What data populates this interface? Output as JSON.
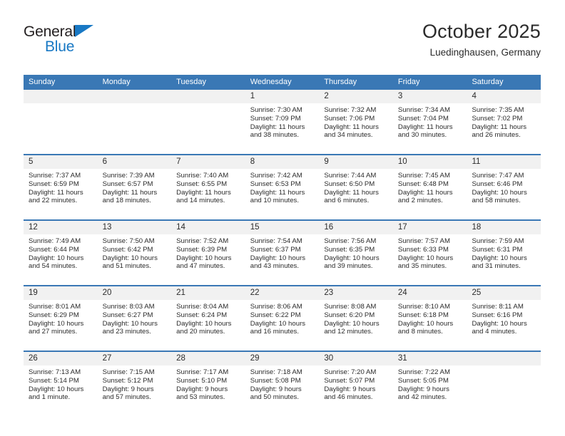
{
  "logo": {
    "line1": "General",
    "line2": "Blue",
    "triangle_icon": "blue-triangle-icon",
    "color_dark": "#231f20",
    "color_blue": "#1878c4"
  },
  "header": {
    "title": "October 2025",
    "subtitle": "Luedinghausen, Germany"
  },
  "theme": {
    "header_blue": "#3a78b5",
    "row_gray": "#f1f1f1",
    "text": "#2b2b2b"
  },
  "calendar": {
    "weekdays": [
      "Sunday",
      "Monday",
      "Tuesday",
      "Wednesday",
      "Thursday",
      "Friday",
      "Saturday"
    ],
    "weeks": [
      [
        {
          "day": "",
          "lines": []
        },
        {
          "day": "",
          "lines": []
        },
        {
          "day": "",
          "lines": []
        },
        {
          "day": "1",
          "lines": [
            "Sunrise: 7:30 AM",
            "Sunset: 7:09 PM",
            "Daylight: 11 hours and 38 minutes."
          ]
        },
        {
          "day": "2",
          "lines": [
            "Sunrise: 7:32 AM",
            "Sunset: 7:06 PM",
            "Daylight: 11 hours and 34 minutes."
          ]
        },
        {
          "day": "3",
          "lines": [
            "Sunrise: 7:34 AM",
            "Sunset: 7:04 PM",
            "Daylight: 11 hours and 30 minutes."
          ]
        },
        {
          "day": "4",
          "lines": [
            "Sunrise: 7:35 AM",
            "Sunset: 7:02 PM",
            "Daylight: 11 hours and 26 minutes."
          ]
        }
      ],
      [
        {
          "day": "5",
          "lines": [
            "Sunrise: 7:37 AM",
            "Sunset: 6:59 PM",
            "Daylight: 11 hours and 22 minutes."
          ]
        },
        {
          "day": "6",
          "lines": [
            "Sunrise: 7:39 AM",
            "Sunset: 6:57 PM",
            "Daylight: 11 hours and 18 minutes."
          ]
        },
        {
          "day": "7",
          "lines": [
            "Sunrise: 7:40 AM",
            "Sunset: 6:55 PM",
            "Daylight: 11 hours and 14 minutes."
          ]
        },
        {
          "day": "8",
          "lines": [
            "Sunrise: 7:42 AM",
            "Sunset: 6:53 PM",
            "Daylight: 11 hours and 10 minutes."
          ]
        },
        {
          "day": "9",
          "lines": [
            "Sunrise: 7:44 AM",
            "Sunset: 6:50 PM",
            "Daylight: 11 hours and 6 minutes."
          ]
        },
        {
          "day": "10",
          "lines": [
            "Sunrise: 7:45 AM",
            "Sunset: 6:48 PM",
            "Daylight: 11 hours and 2 minutes."
          ]
        },
        {
          "day": "11",
          "lines": [
            "Sunrise: 7:47 AM",
            "Sunset: 6:46 PM",
            "Daylight: 10 hours and 58 minutes."
          ]
        }
      ],
      [
        {
          "day": "12",
          "lines": [
            "Sunrise: 7:49 AM",
            "Sunset: 6:44 PM",
            "Daylight: 10 hours and 54 minutes."
          ]
        },
        {
          "day": "13",
          "lines": [
            "Sunrise: 7:50 AM",
            "Sunset: 6:42 PM",
            "Daylight: 10 hours and 51 minutes."
          ]
        },
        {
          "day": "14",
          "lines": [
            "Sunrise: 7:52 AM",
            "Sunset: 6:39 PM",
            "Daylight: 10 hours and 47 minutes."
          ]
        },
        {
          "day": "15",
          "lines": [
            "Sunrise: 7:54 AM",
            "Sunset: 6:37 PM",
            "Daylight: 10 hours and 43 minutes."
          ]
        },
        {
          "day": "16",
          "lines": [
            "Sunrise: 7:56 AM",
            "Sunset: 6:35 PM",
            "Daylight: 10 hours and 39 minutes."
          ]
        },
        {
          "day": "17",
          "lines": [
            "Sunrise: 7:57 AM",
            "Sunset: 6:33 PM",
            "Daylight: 10 hours and 35 minutes."
          ]
        },
        {
          "day": "18",
          "lines": [
            "Sunrise: 7:59 AM",
            "Sunset: 6:31 PM",
            "Daylight: 10 hours and 31 minutes."
          ]
        }
      ],
      [
        {
          "day": "19",
          "lines": [
            "Sunrise: 8:01 AM",
            "Sunset: 6:29 PM",
            "Daylight: 10 hours and 27 minutes."
          ]
        },
        {
          "day": "20",
          "lines": [
            "Sunrise: 8:03 AM",
            "Sunset: 6:27 PM",
            "Daylight: 10 hours and 23 minutes."
          ]
        },
        {
          "day": "21",
          "lines": [
            "Sunrise: 8:04 AM",
            "Sunset: 6:24 PM",
            "Daylight: 10 hours and 20 minutes."
          ]
        },
        {
          "day": "22",
          "lines": [
            "Sunrise: 8:06 AM",
            "Sunset: 6:22 PM",
            "Daylight: 10 hours and 16 minutes."
          ]
        },
        {
          "day": "23",
          "lines": [
            "Sunrise: 8:08 AM",
            "Sunset: 6:20 PM",
            "Daylight: 10 hours and 12 minutes."
          ]
        },
        {
          "day": "24",
          "lines": [
            "Sunrise: 8:10 AM",
            "Sunset: 6:18 PM",
            "Daylight: 10 hours and 8 minutes."
          ]
        },
        {
          "day": "25",
          "lines": [
            "Sunrise: 8:11 AM",
            "Sunset: 6:16 PM",
            "Daylight: 10 hours and 4 minutes."
          ]
        }
      ],
      [
        {
          "day": "26",
          "lines": [
            "Sunrise: 7:13 AM",
            "Sunset: 5:14 PM",
            "Daylight: 10 hours and 1 minute."
          ]
        },
        {
          "day": "27",
          "lines": [
            "Sunrise: 7:15 AM",
            "Sunset: 5:12 PM",
            "Daylight: 9 hours and 57 minutes."
          ]
        },
        {
          "day": "28",
          "lines": [
            "Sunrise: 7:17 AM",
            "Sunset: 5:10 PM",
            "Daylight: 9 hours and 53 minutes."
          ]
        },
        {
          "day": "29",
          "lines": [
            "Sunrise: 7:18 AM",
            "Sunset: 5:08 PM",
            "Daylight: 9 hours and 50 minutes."
          ]
        },
        {
          "day": "30",
          "lines": [
            "Sunrise: 7:20 AM",
            "Sunset: 5:07 PM",
            "Daylight: 9 hours and 46 minutes."
          ]
        },
        {
          "day": "31",
          "lines": [
            "Sunrise: 7:22 AM",
            "Sunset: 5:05 PM",
            "Daylight: 9 hours and 42 minutes."
          ]
        },
        {
          "day": "",
          "lines": []
        }
      ]
    ]
  }
}
